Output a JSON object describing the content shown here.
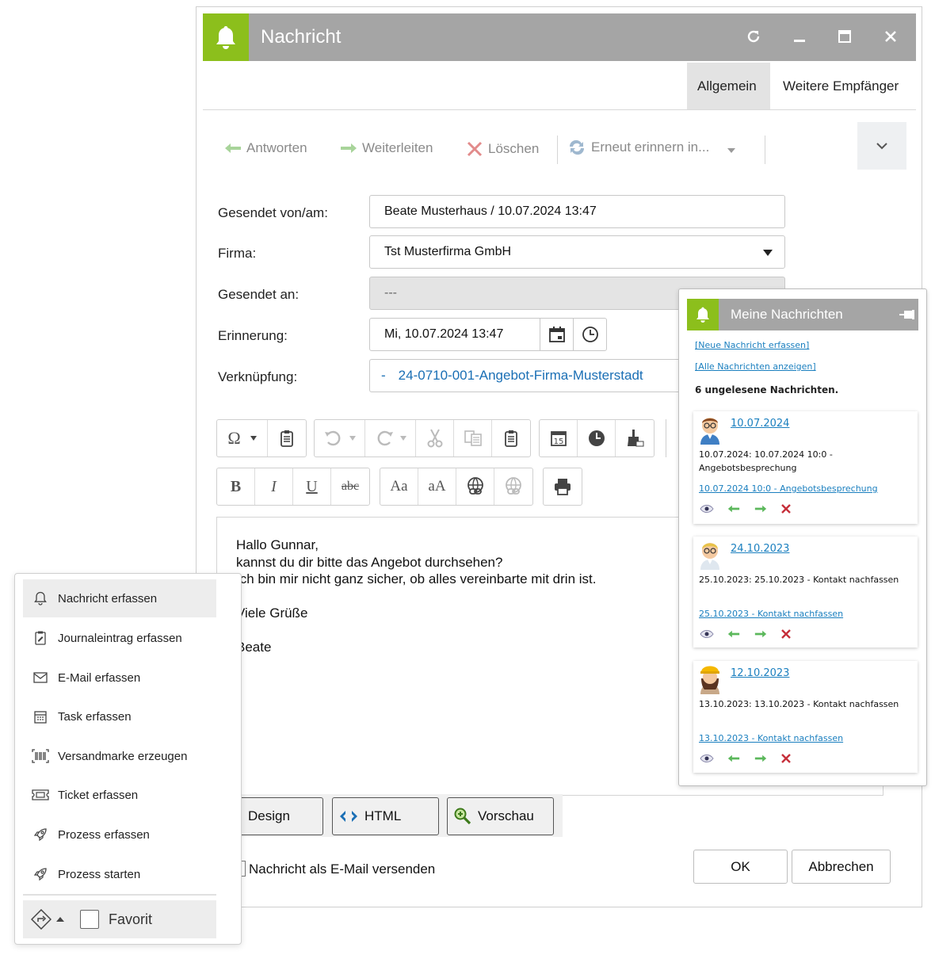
{
  "window": {
    "title": "Nachricht",
    "tabs": [
      "Allgemein",
      "Weitere Empfänger"
    ]
  },
  "toolbar": {
    "reply": "Antworten",
    "forward": "Weiterleiten",
    "delete": "Löschen",
    "remind": "Erneut erinnern in..."
  },
  "form": {
    "sent_label": "Gesendet von/am:",
    "sent_value": "Beate Musterhaus / 10.07.2024 13:47",
    "company_label": "Firma:",
    "company_value": "Tst Musterfirma GmbH",
    "sent_to_label": "Gesendet an:",
    "sent_to_value": "---",
    "reminder_label": "Erinnerung:",
    "reminder_value": "Mi, 10.07.2024 13:47",
    "link_label": "Verknüpfung:",
    "link_prefix": "-",
    "link_value": "24-0710-001-Angebot-Firma-Musterstadt"
  },
  "editor": {
    "lines": [
      "Hallo Gunnar,",
      "kannst du dir bitte das Angebot durchsehen?",
      "Ich bin mir nicht ganz sicher, ob alles vereinbarte mit drin ist.",
      "",
      "Viele Grüße",
      "",
      "Beate"
    ],
    "modes": [
      "Design",
      "HTML",
      "Vorschau"
    ]
  },
  "footer": {
    "email_checkbox_label": "Nachricht als E-Mail versenden",
    "ok": "OK",
    "cancel": "Abbrechen"
  },
  "notifications": {
    "title": "Meine Nachrichten",
    "new_link": "[Neue Nachricht erfassen]",
    "all_link": "[Alle Nachrichten anzeigen]",
    "unread": "6 ungelesene Nachrichten.",
    "items": [
      {
        "date": "10.07.2024",
        "text": "10.07.2024: 10.07.2024 10:0 - Angebotsbesprechung",
        "link": "10.07.2024 10:0 - Angebotsbesprechung"
      },
      {
        "date": "24.10.2023",
        "text": "25.10.2023: 25.10.2023 - Kontakt nachfassen",
        "link": "25.10.2023 - Kontakt nachfassen"
      },
      {
        "date": "12.10.2023",
        "text": "13.10.2023: 13.10.2023 - Kontakt nachfassen",
        "link": "13.10.2023 - Kontakt nachfassen"
      }
    ]
  },
  "menu": {
    "items": [
      {
        "label": "Nachricht erfassen",
        "icon": "bell-icon"
      },
      {
        "label": "Journaleintrag erfassen",
        "icon": "journal-icon"
      },
      {
        "label": "E-Mail erfassen",
        "icon": "envelope-icon"
      },
      {
        "label": "Task erfassen",
        "icon": "calendar-icon"
      },
      {
        "label": "Versandmarke erzeugen",
        "icon": "barcode-icon"
      },
      {
        "label": "Ticket erfassen",
        "icon": "ticket-icon"
      },
      {
        "label": "Prozess erfassen",
        "icon": "rocket-icon"
      },
      {
        "label": "Prozess starten",
        "icon": "rocket-icon"
      }
    ],
    "favorite_label": "Favorit"
  },
  "colors": {
    "accent_green": "#8cbf1c",
    "titlebar_gray": "#a5a5a5",
    "link_blue": "#1a7fbf"
  }
}
